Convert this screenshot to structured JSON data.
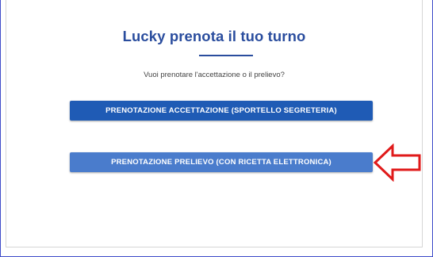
{
  "page": {
    "title": "Lucky prenota il tuo turno",
    "question": "Vuoi prenotare l'accettazione o il prelievo?"
  },
  "buttons": {
    "accettazione_label": "PRENOTAZIONE ACCETTAZIONE (SPORTELLO SEGRETERIA)",
    "prelievo_label": "PRENOTAZIONE PRELIEVO (CON RICETTA ELETTRONICA)"
  },
  "annotation": {
    "arrow_icon": "left-arrow-icon",
    "arrow_color": "#e01a1a"
  },
  "colors": {
    "accent": "#2a4d9e",
    "primary_button": "#1f5bb5",
    "secondary_button": "#4a7ccc"
  }
}
